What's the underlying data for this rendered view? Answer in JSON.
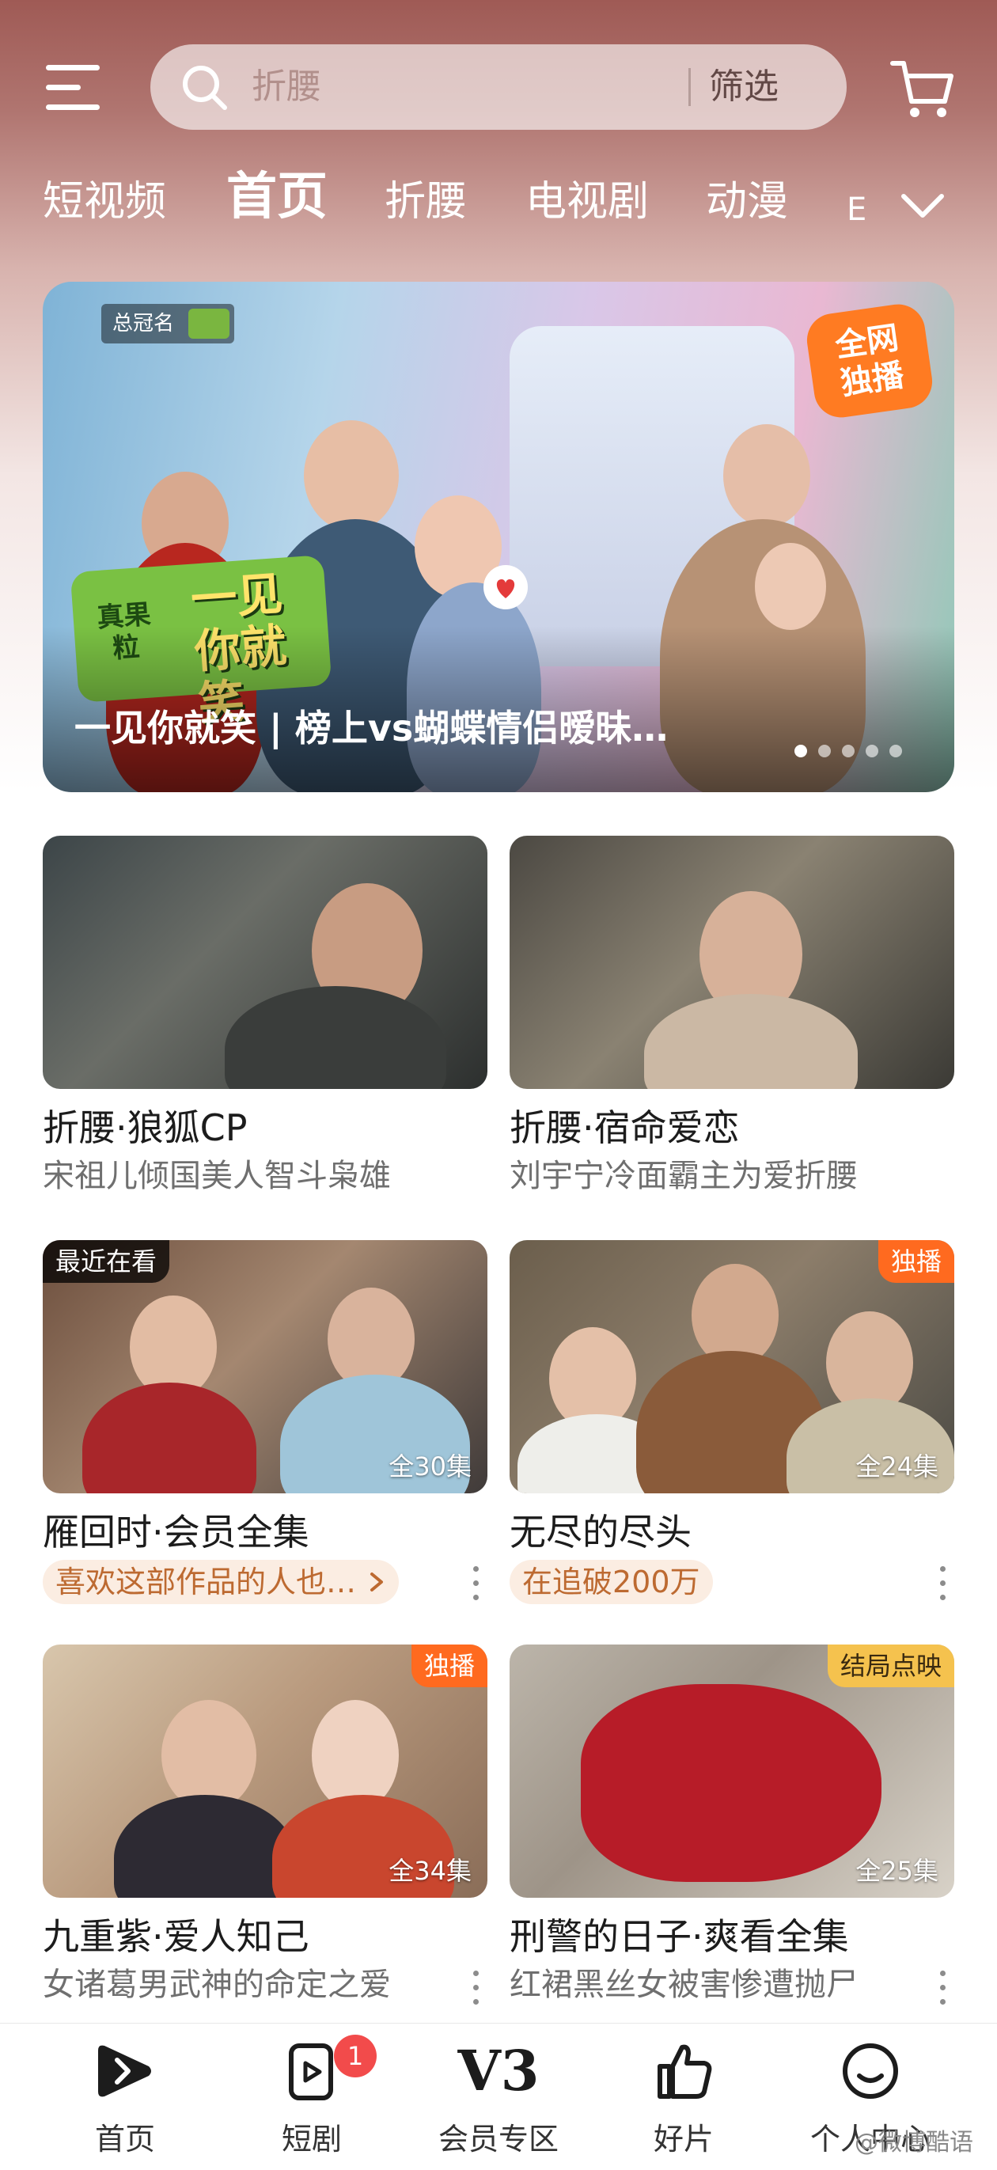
{
  "header": {
    "search_placeholder": "折腰",
    "filter_label": "筛选"
  },
  "tabs": [
    {
      "label": "短视频"
    },
    {
      "label": "首页"
    },
    {
      "label": "折腰"
    },
    {
      "label": "电视剧"
    },
    {
      "label": "动漫"
    },
    {
      "label": "E"
    }
  ],
  "banner": {
    "sponsor_label": "总冠名",
    "exclusive_label": [
      "全网",
      "独播"
    ],
    "logo_brand": "真果粒",
    "logo_text": "一见你就笑",
    "title": "一见你就笑 | 榜上vs蝴蝶情侣暧昧…",
    "slide_count": 5,
    "active_slide": 1
  },
  "cards": [
    {
      "title": "折腰·狼狐CP",
      "subtitle": "宋祖儿倾国美人智斗枭雄",
      "badge": "",
      "episodes": ""
    },
    {
      "title": "折腰·宿命爱恋",
      "subtitle": "刘宇宁冷面霸主为爱折腰",
      "badge": "",
      "episodes": ""
    },
    {
      "title": "雁回时·会员全集",
      "subtitle": "喜欢这部作品的人也…",
      "badge": "最近在看",
      "episodes": "全30集"
    },
    {
      "title": "无尽的尽头",
      "subtitle": "在追破200万",
      "badge": "独播",
      "episodes": "全24集"
    },
    {
      "title": "九重紫·爱人知己",
      "subtitle": "女诸葛男武神的命定之爱",
      "badge": "独播",
      "episodes": "全34集"
    },
    {
      "title": "刑警的日子·爽看全集",
      "subtitle": "红裙黑丝女被害惨遭抛尸",
      "badge": "结局点映",
      "episodes": "全25集"
    }
  ],
  "bottom_nav": [
    {
      "label": "首页",
      "icon": "play-logo-icon"
    },
    {
      "label": "短剧",
      "icon": "short-drama-icon",
      "badge": "1"
    },
    {
      "label": "会员专区",
      "icon": "vip-v3-icon",
      "icon_text": "V3"
    },
    {
      "label": "好片",
      "icon": "thumbs-up-icon"
    },
    {
      "label": "个人中心",
      "icon": "smile-face-icon"
    }
  ],
  "watermark": "@微博酷语",
  "colors": {
    "accent_orange": "#ff7b22",
    "chip_text": "#bd6a31",
    "badge_red": "#f24b4b",
    "badge_gold": "#f5c24e"
  }
}
